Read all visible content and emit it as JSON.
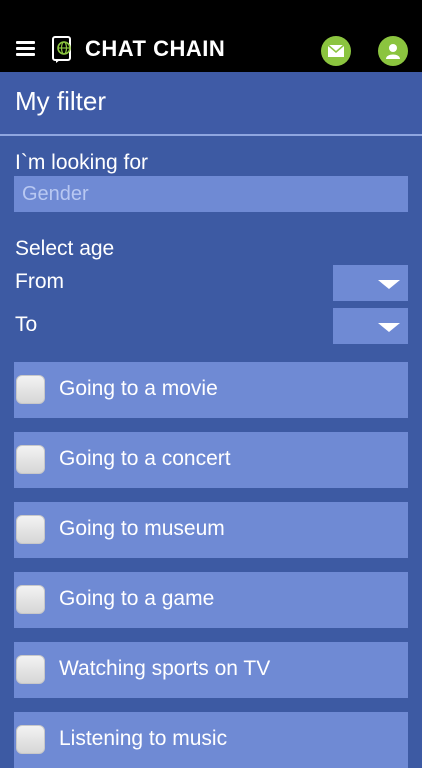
{
  "topbar": {
    "menu_icon": "hamburger-icon",
    "logo_icon": "globe-phone-icon",
    "app_title": "CHAT CHAIN",
    "mail_icon": "mail-icon",
    "profile_icon": "user-icon",
    "accent_color": "#8bc43f"
  },
  "header": {
    "title": "My filter"
  },
  "filter": {
    "looking_for_label": "I`m looking for",
    "gender_placeholder": "Gender",
    "select_age_label": "Select age",
    "from_label": "From",
    "to_label": "To",
    "from_value": "",
    "to_value": ""
  },
  "options": [
    {
      "label": "Going to a movie",
      "checked": false
    },
    {
      "label": "Going to a concert",
      "checked": false
    },
    {
      "label": "Going to museum",
      "checked": false
    },
    {
      "label": "Going to a game",
      "checked": false
    },
    {
      "label": "Watching sports on TV",
      "checked": false
    },
    {
      "label": "Listening to music",
      "checked": false
    }
  ]
}
